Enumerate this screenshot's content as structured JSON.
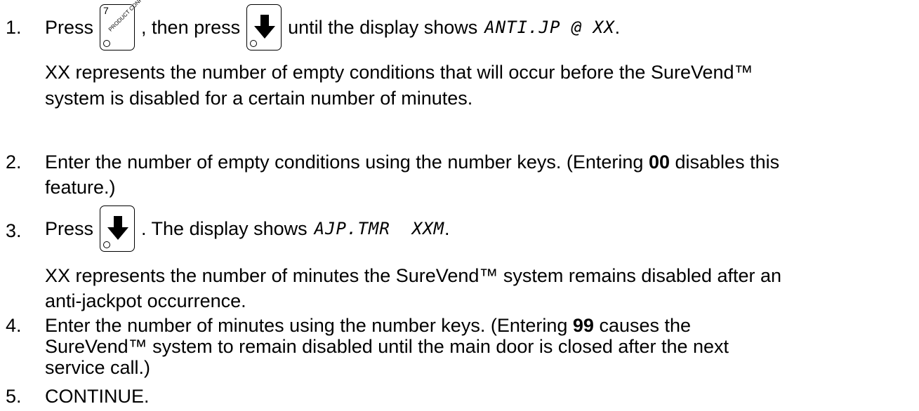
{
  "steps": [
    {
      "number": "1.",
      "line1": {
        "t1": "Press",
        "key1": {
          "icon": "product-config-key",
          "number": "7",
          "label": "PRODUCT CONFIG."
        },
        "t2": ", then press",
        "key2": {
          "icon": "down-arrow-key"
        },
        "t3": "until the display shows",
        "display": "ANTI.JP @ XX",
        "t4": "."
      },
      "para": [
        "XX represents the number of empty conditions that will occur before the SureVend™",
        "system is disabled for a certain number of minutes."
      ]
    },
    {
      "number": "2.",
      "line1": {
        "pre": "Enter the number of empty conditions using the number keys.  (Entering ",
        "bold": "00",
        "post": " disables this"
      },
      "line2": "feature.)"
    },
    {
      "number": "3.",
      "line1": {
        "t1": "Press",
        "key": {
          "icon": "down-arrow-key"
        },
        "t2": ".  The display shows",
        "display": "AJP.TMR  XXM",
        "t3": "."
      },
      "para": [
        "XX represents the number of minutes the SureVend™ system remains disabled after an",
        "anti-jackpot occurrence."
      ]
    },
    {
      "number": "4.",
      "line1": {
        "pre": "Enter the number of minutes using the number keys.  (Entering ",
        "bold": "99",
        "post": " causes the"
      },
      "line2": "SureVend™ system to remain disabled until the main door is closed after the next",
      "line3": "service call.)"
    },
    {
      "number": "5.",
      "text": "CONTINUE."
    }
  ]
}
